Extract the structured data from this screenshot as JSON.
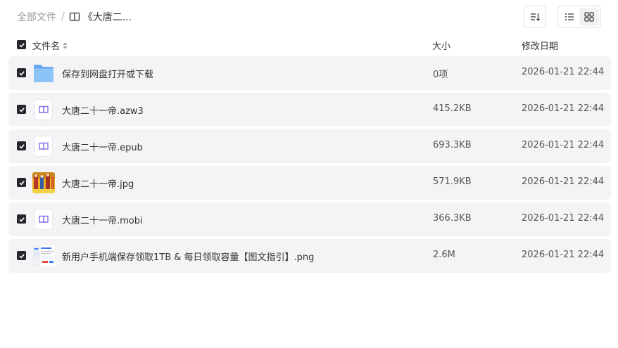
{
  "breadcrumb": {
    "root": "全部文件",
    "separator": "/",
    "current": "《大唐二..."
  },
  "toolbar": {
    "sort_icon": "sort-lines-icon",
    "view_list_icon": "list-view-icon",
    "view_grid_icon": "grid-view-icon"
  },
  "table": {
    "columns": {
      "name": "文件名",
      "size": "大小",
      "date": "修改日期"
    },
    "rows": [
      {
        "name": "保存到网盘打开或下载",
        "size": "0项",
        "date": "2026-01-21 22:44",
        "type": "folder-icon"
      },
      {
        "name": "大唐二十一帝.azw3",
        "size": "415.2KB",
        "date": "2026-01-21 22:44",
        "type": "ebook-icon"
      },
      {
        "name": "大唐二十一帝.epub",
        "size": "693.3KB",
        "date": "2026-01-21 22:44",
        "type": "ebook-icon"
      },
      {
        "name": "大唐二十一帝.jpg",
        "size": "571.9KB",
        "date": "2026-01-21 22:44",
        "type": "image-thumbnail"
      },
      {
        "name": "大唐二十一帝.mobi",
        "size": "366.3KB",
        "date": "2026-01-21 22:44",
        "type": "ebook-icon"
      },
      {
        "name": "新用户手机端保存领取1TB & 每日领取容量【图文指引】.png",
        "size": "2.6M",
        "date": "2026-01-21 22:44",
        "type": "screenshot-thumbnail"
      }
    ]
  },
  "colors": {
    "row_bg": "#f4f4f6",
    "checkbox": "#25252c",
    "folder": "#7fb9f5",
    "ebook_accent": "#8a72e8",
    "muted_text": "#9a9aa2"
  }
}
